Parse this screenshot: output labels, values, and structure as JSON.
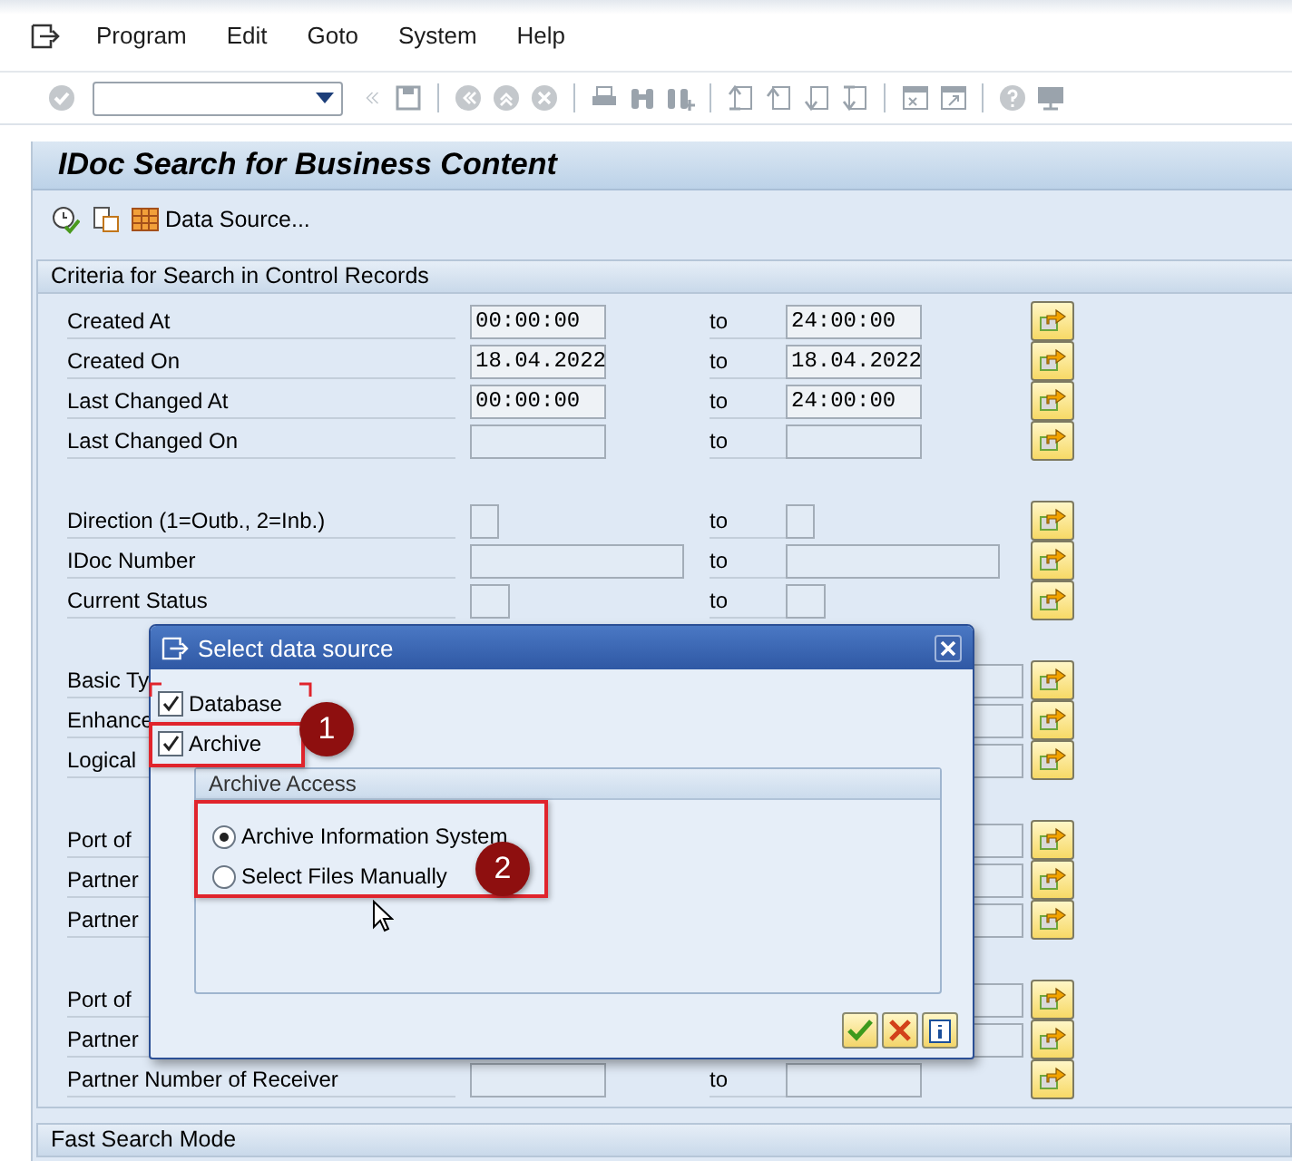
{
  "menu": [
    "Program",
    "Edit",
    "Goto",
    "System",
    "Help"
  ],
  "title": "IDoc Search for Business Content",
  "app_toolbar": {
    "data_source": "Data Source..."
  },
  "criteria": {
    "title": "Criteria for Search in Control Records",
    "groups": [
      [
        {
          "label": "Created At",
          "from": "00:00:00",
          "to_label": "to",
          "to": "24:00:00",
          "kind": "time"
        },
        {
          "label": "Created On",
          "from": "18.04.2022",
          "to_label": "to",
          "to": "18.04.2022",
          "kind": "date"
        },
        {
          "label": "Last Changed At",
          "from": "00:00:00",
          "to_label": "to",
          "to": "24:00:00",
          "kind": "time"
        },
        {
          "label": "Last Changed On",
          "to_label": "to",
          "kind": "date"
        }
      ],
      [
        {
          "label": "Direction (1=Outb., 2=Inb.)",
          "to_label": "to",
          "kind": "flag"
        },
        {
          "label": "IDoc Number",
          "to_label": "to",
          "kind": "number"
        },
        {
          "label": "Current Status",
          "to_label": "to",
          "kind": "status"
        }
      ],
      [
        {
          "label": "Basic Ty",
          "kind": "text"
        },
        {
          "label": "Enhance",
          "kind": "text"
        },
        {
          "label": "Logical",
          "kind": "text"
        }
      ],
      [
        {
          "label": "Port of",
          "kind": "text"
        },
        {
          "label": "Partner",
          "kind": "text"
        },
        {
          "label": "Partner",
          "kind": "text"
        }
      ],
      [
        {
          "label": "Port of",
          "kind": "text"
        },
        {
          "label": "Partner",
          "kind": "text"
        },
        {
          "label": "Partner Number of Receiver",
          "to_label": "to",
          "kind": "date"
        }
      ]
    ]
  },
  "next_section": {
    "title": "Fast Search Mode"
  },
  "dialog": {
    "title": "Select data source",
    "checkboxes": [
      {
        "label": "Database",
        "checked": true
      },
      {
        "label": "Archive",
        "checked": true
      }
    ],
    "archive_access": {
      "title": "Archive Access",
      "options": [
        {
          "label": "Archive Information System",
          "selected": true
        },
        {
          "label": "Select Files Manually",
          "selected": false
        }
      ]
    }
  },
  "annotations": [
    {
      "number": "1"
    },
    {
      "number": "2"
    }
  ]
}
